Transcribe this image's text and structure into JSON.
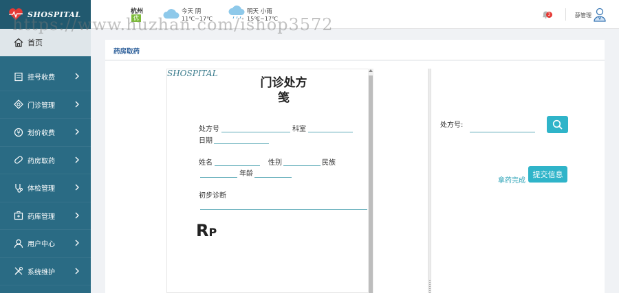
{
  "brand": {
    "name": "SHOSPITAL"
  },
  "sidebar": {
    "home": "首页",
    "items": [
      {
        "label": "挂号收费",
        "icon": "receipt-icon"
      },
      {
        "label": "门诊管理",
        "icon": "diamond-icon"
      },
      {
        "label": "划价收费",
        "icon": "coin-icon"
      },
      {
        "label": "药房取药",
        "icon": "medicine-icon"
      },
      {
        "label": "体检管理",
        "icon": "stethoscope-icon"
      },
      {
        "label": "药库管理",
        "icon": "medkit-icon"
      },
      {
        "label": "用户中心",
        "icon": "user-icon"
      },
      {
        "label": "系统维护",
        "icon": "tools-icon"
      }
    ]
  },
  "weather": {
    "city": "杭州",
    "aqi": "优",
    "today": {
      "label": "今天 阴",
      "temp": "11℃~17℃"
    },
    "tomorrow": {
      "label": "明天 小雨",
      "temp": "15℃~17℃"
    }
  },
  "topbar": {
    "notifications": "3",
    "user": "薛管理"
  },
  "watermark": "https://www.huzhan.com/ishop3572",
  "page": {
    "title": "药房取药"
  },
  "prescription": {
    "logo": "SHOSPITAL",
    "title_line1": "门诊处方",
    "title_line2": "笺",
    "rx_number": "处方号",
    "department": "科室",
    "date": "日期",
    "name": "姓名",
    "gender": "性别",
    "ethnicity": "民族",
    "age": "年龄",
    "diagnosis": "初步诊断",
    "rp": "R",
    "rp_sub": "P"
  },
  "query": {
    "label": "处方号:",
    "value": "",
    "done_link": "拿药完成",
    "submit": "提交信息"
  },
  "colors": {
    "sidebar": "#2a6b84",
    "accent": "#2fb4c9",
    "title": "#2d5f9a"
  }
}
